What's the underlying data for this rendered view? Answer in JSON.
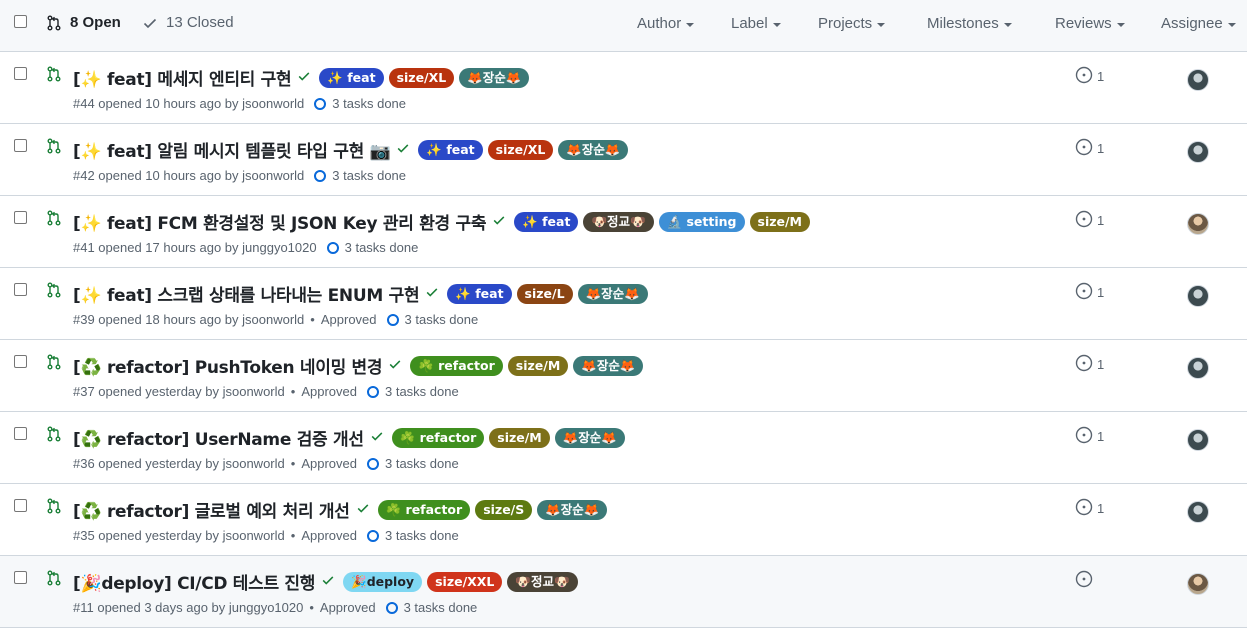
{
  "header": {
    "open_label": "8 Open",
    "closed_label": "13 Closed",
    "filters": [
      "Author",
      "Label",
      "Projects",
      "Milestones",
      "Reviews",
      "Assignee"
    ]
  },
  "colors": {
    "feat": "#2a49c8",
    "size_red": "#b9330e",
    "size_l": "#8b4513",
    "size_m": "#7d7019",
    "size_s": "#5d7a11",
    "size_xxl": "#d0341b",
    "jangsun": "#3b7977",
    "jeonggyo": "#4a4336",
    "setting": "#3d8fd6",
    "refactor": "#3f8f1e",
    "deploy": "#7fd7f2",
    "open_green": "#1a7f37",
    "link_blue": "#0969da"
  },
  "prs": [
    {
      "title": "[✨ feat] 메세지 엔티티 구현",
      "labels": [
        {
          "text": "✨ feat",
          "color": "#2a49c8"
        },
        {
          "text": "size/XL",
          "color": "#b9330e"
        },
        {
          "text": "🦊장순🦊",
          "color": "#3b7977"
        }
      ],
      "meta": "#44 opened 10 hours ago by jsoonworld",
      "approved": "",
      "tasks": "3 tasks done",
      "reviews": "1",
      "avatar": "dark"
    },
    {
      "title": "[✨ feat] 알림 메시지 템플릿 타입 구현 📷",
      "labels": [
        {
          "text": "✨ feat",
          "color": "#2a49c8"
        },
        {
          "text": "size/XL",
          "color": "#b9330e"
        },
        {
          "text": "🦊장순🦊",
          "color": "#3b7977"
        }
      ],
      "meta": "#42 opened 10 hours ago by jsoonworld",
      "approved": "",
      "tasks": "3 tasks done",
      "reviews": "1",
      "avatar": "dark"
    },
    {
      "title": "[✨ feat] FCM 환경설정 및 JSON Key 관리 환경 구축",
      "labels": [
        {
          "text": "✨ feat",
          "color": "#2a49c8"
        },
        {
          "text": "🐶정교🐶",
          "color": "#4a4336"
        },
        {
          "text": "🔬 setting",
          "color": "#3d8fd6"
        },
        {
          "text": "size/M",
          "color": "#7d7019"
        }
      ],
      "meta": "#41 opened 17 hours ago by junggyo1020",
      "approved": "",
      "tasks": "3 tasks done",
      "reviews": "1",
      "avatar": "warm"
    },
    {
      "title": "[✨ feat] 스크랩 상태를 나타내는 ENUM 구현",
      "labels": [
        {
          "text": "✨ feat",
          "color": "#2a49c8"
        },
        {
          "text": "size/L",
          "color": "#8b4513"
        },
        {
          "text": "🦊장순🦊",
          "color": "#3b7977"
        }
      ],
      "meta": "#39 opened 18 hours ago by jsoonworld",
      "approved": "Approved",
      "tasks": "3 tasks done",
      "reviews": "1",
      "avatar": "dark"
    },
    {
      "title": "[♻️ refactor] PushToken 네이밍 변경",
      "labels": [
        {
          "text": "☘️ refactor",
          "color": "#3f8f1e"
        },
        {
          "text": "size/M",
          "color": "#7d7019"
        },
        {
          "text": "🦊장순🦊",
          "color": "#3b7977"
        }
      ],
      "meta": "#37 opened yesterday by jsoonworld",
      "approved": "Approved",
      "tasks": "3 tasks done",
      "reviews": "1",
      "avatar": "dark"
    },
    {
      "title": "[♻️ refactor] UserName 검증 개선",
      "labels": [
        {
          "text": "☘️ refactor",
          "color": "#3f8f1e"
        },
        {
          "text": "size/M",
          "color": "#7d7019"
        },
        {
          "text": "🦊장순🦊",
          "color": "#3b7977"
        }
      ],
      "meta": "#36 opened yesterday by jsoonworld",
      "approved": "Approved",
      "tasks": "3 tasks done",
      "reviews": "1",
      "avatar": "dark"
    },
    {
      "title": "[♻️ refactor] 글로벌 예외 처리 개선",
      "labels": [
        {
          "text": "☘️ refactor",
          "color": "#3f8f1e"
        },
        {
          "text": "size/S",
          "color": "#5d7a11"
        },
        {
          "text": "🦊장순🦊",
          "color": "#3b7977"
        }
      ],
      "meta": "#35 opened yesterday by jsoonworld",
      "approved": "Approved",
      "tasks": "3 tasks done",
      "reviews": "1",
      "avatar": "dark"
    },
    {
      "title": "[🎉deploy] CI/CD 테스트 진행",
      "labels": [
        {
          "text": "🎉deploy",
          "color": "#7fd7f2",
          "dark": true
        },
        {
          "text": "size/XXL",
          "color": "#d0341b"
        },
        {
          "text": "🐶정교🐶",
          "color": "#4a4336"
        }
      ],
      "meta": "#11 opened 3 days ago by junggyo1020",
      "approved": "Approved",
      "tasks": "3 tasks done",
      "reviews": "",
      "avatar": "warm"
    }
  ]
}
